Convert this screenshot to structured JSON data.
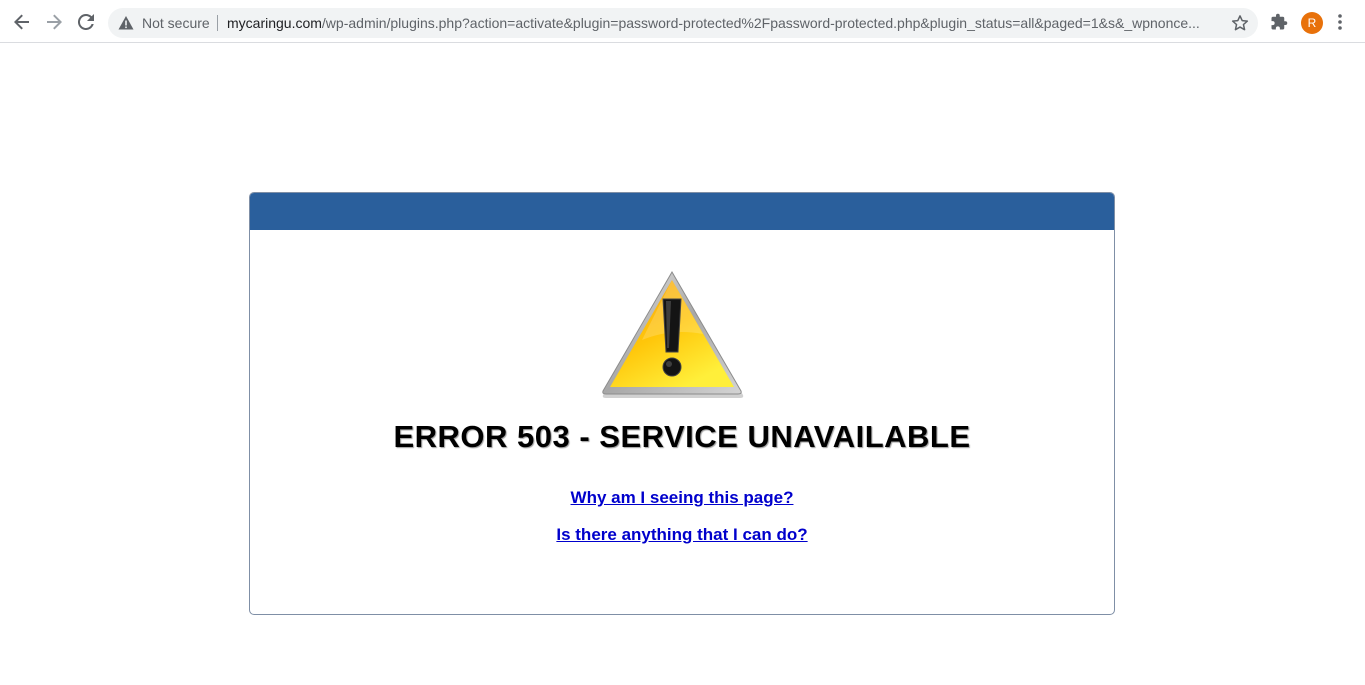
{
  "browser": {
    "security_label": "Not secure",
    "url_host": "mycaringu.com",
    "url_path": "/wp-admin/plugins.php?action=activate&plugin=password-protected%2Fpassword-protected.php&plugin_status=all&paged=1&s&_wpnonce...",
    "profile_initial": "R",
    "icons": {
      "back": "back-arrow-icon",
      "forward": "forward-arrow-icon",
      "reload": "reload-icon",
      "security": "warning-triangle-icon",
      "bookmark": "star-icon",
      "extensions": "puzzle-icon",
      "menu": "kebab-menu-icon"
    },
    "colors": {
      "avatar": "#e8710a"
    }
  },
  "page": {
    "title": "ERROR 503 - SERVICE UNAVAILABLE",
    "links": [
      {
        "label": "Why am I seeing this page?"
      },
      {
        "label": "Is there anything that I can do?"
      }
    ],
    "colors": {
      "header": "#2a5f9c",
      "link": "#0000cc",
      "warning_fill": "#ffc400"
    }
  }
}
